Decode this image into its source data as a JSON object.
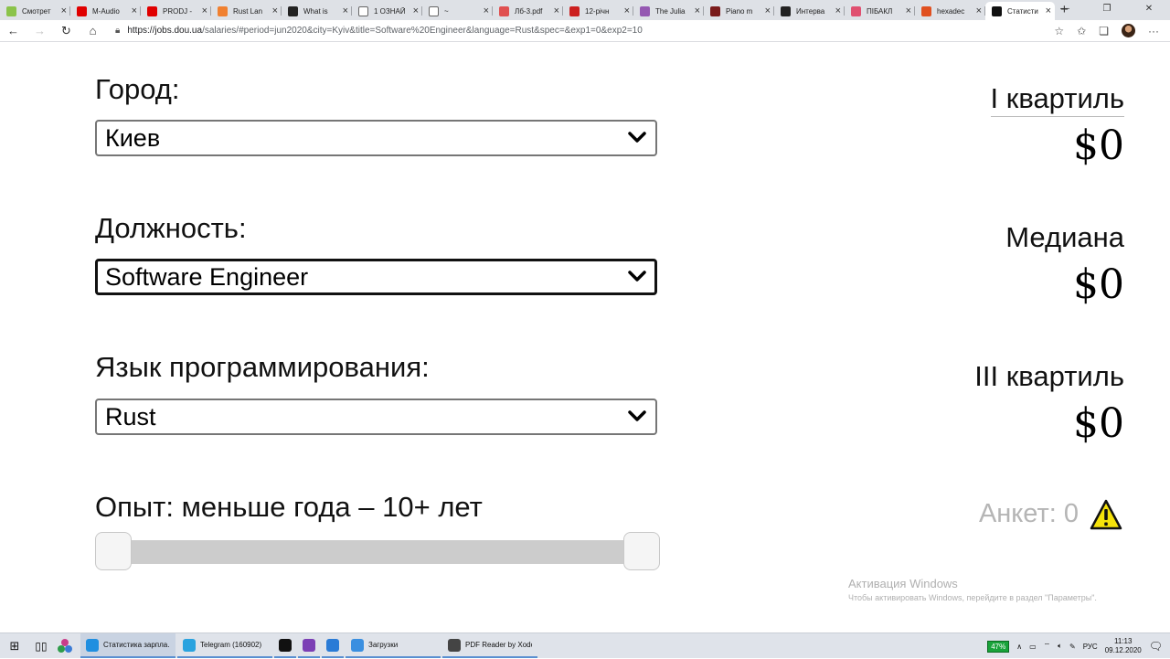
{
  "browser": {
    "tabs": [
      {
        "title": "Смотрет",
        "color": "#8bc34a"
      },
      {
        "title": "M-Audio",
        "color": "#e00000"
      },
      {
        "title": "PRODJ -",
        "color": "#e00000"
      },
      {
        "title": "Rust Lan",
        "color": "#f08030"
      },
      {
        "title": "What is",
        "color": "#222222"
      },
      {
        "title": "1 ОЗНАЙ",
        "color": "#ffffff"
      },
      {
        "title": "~",
        "color": "#ffffff"
      },
      {
        "title": "Лб-3.pdf",
        "color": "#e05050"
      },
      {
        "title": "12-річн",
        "color": "#cc2020"
      },
      {
        "title": "The Julia",
        "color": "#9558b2"
      },
      {
        "title": "Piano m",
        "color": "#7a1b1b"
      },
      {
        "title": "Интерва",
        "color": "#222222"
      },
      {
        "title": "ПІБАКЛ",
        "color": "#e05070"
      },
      {
        "title": "hexadec",
        "color": "#e05020"
      },
      {
        "title": "Статисти",
        "color": "#111111",
        "active": true
      }
    ],
    "url_host": "https://jobs.dou.ua",
    "url_rest": "/salaries/#period=jun2020&city=Kyiv&title=Software%20Engineer&language=Rust&spec=&exp1=0&exp2=10"
  },
  "form": {
    "city_label": "Город:",
    "city_value": "Киев",
    "position_label": "Должность:",
    "position_value": "Software Engineer",
    "language_label": "Язык программирования:",
    "language_value": "Rust",
    "experience_label": "Опыт: меньше года – 10+ лет",
    "experience_min": 0,
    "experience_max": 10,
    "experience_range": [
      0,
      10
    ]
  },
  "stats": {
    "q1_label": "I квартиль",
    "q1_value": "$0",
    "median_label": "Медиана",
    "median_value": "$0",
    "q3_label": "III квартиль",
    "q3_value": "$0",
    "responses": "Анкет: 0"
  },
  "watermark": {
    "line1": "Активация Windows",
    "line2": "Чтобы активировать Windows, перейдите в раздел \"Параметры\"."
  },
  "taskbar": {
    "items": [
      {
        "label": "Статистика зарпла...",
        "color": "#1f8fe0",
        "active": true
      },
      {
        "label": "Telegram (160902)",
        "color": "#2aa3df"
      },
      {
        "label": "",
        "color": "#111111"
      },
      {
        "label": "",
        "color": "#7b3fb5"
      },
      {
        "label": "",
        "color": "#2a7bd6"
      },
      {
        "label": "Загрузки",
        "color": "#3a8fe0"
      },
      {
        "label": "PDF Reader by Xodo",
        "color": "#444444"
      }
    ],
    "battery": "47%",
    "lang": "РУС",
    "time": "11:13",
    "date": "09.12.2020"
  },
  "colors": {
    "warning": "#f5e20a",
    "select_border": "#767676",
    "track": "#cccccc"
  }
}
